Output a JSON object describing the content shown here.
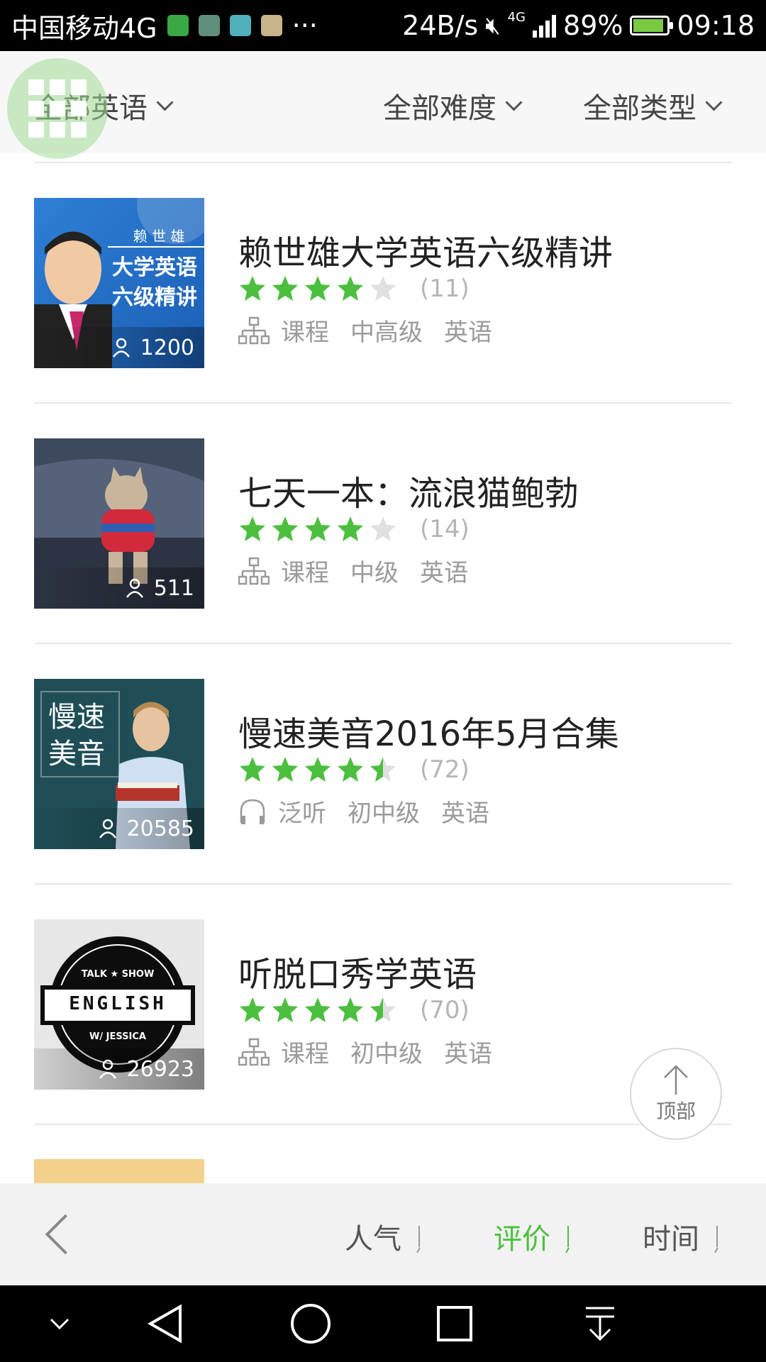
{
  "status_bar": {
    "carrier": "中国移动4G",
    "speed": "24B/s",
    "network": "4G",
    "battery_pct": "89%",
    "time": "09:18"
  },
  "filters": {
    "language": "全部英语",
    "difficulty": "全部难度",
    "type": "全部类型"
  },
  "courses": [
    {
      "title": "赖世雄大学英语六级精讲",
      "rating": 4,
      "rating_count": "(11)",
      "type_icon": "course-icon",
      "type": "课程",
      "level": "中高级",
      "language": "英语",
      "learners": "1200",
      "thumb": {
        "name": "赖 世 雄",
        "line1": "大学英语",
        "line2": "六级精讲"
      }
    },
    {
      "title": "七天一本：流浪猫鲍勃",
      "rating": 4,
      "rating_count": "(14)",
      "type_icon": "course-icon",
      "type": "课程",
      "level": "中级",
      "language": "英语",
      "learners": "511"
    },
    {
      "title": "慢速美音2016年5月合集",
      "rating": 4.5,
      "rating_count": "(72)",
      "type_icon": "headphones-icon",
      "type": "泛听",
      "level": "初中级",
      "language": "英语",
      "learners": "20585",
      "thumb": {
        "line1": "慢速",
        "line2": "美音"
      }
    },
    {
      "title": "听脱口秀学英语",
      "rating": 4.5,
      "rating_count": "(70)",
      "type_icon": "course-icon",
      "type": "课程",
      "level": "初中级",
      "language": "英语",
      "learners": "26923",
      "thumb": {
        "top": "TALK ★ SHOW",
        "mid": "ENGLISH",
        "bot": "W/ JESSICA"
      }
    }
  ],
  "top_button": {
    "label": "顶部"
  },
  "sort_bar": {
    "popularity": "人气",
    "rating": "评价",
    "time": "时间",
    "active": "评价"
  },
  "colors": {
    "accent": "#4cbf3f",
    "star_empty": "#e0e0e0"
  }
}
